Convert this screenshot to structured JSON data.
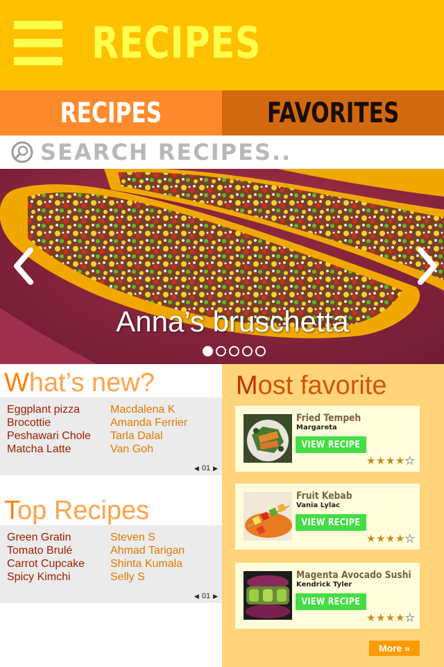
{
  "header": {
    "title": "RECIPES",
    "menu_icon": "hamburger-menu-icon"
  },
  "tabs": [
    {
      "label": "RECIPES",
      "active": true
    },
    {
      "label": "FAVORITES",
      "active": false
    }
  ],
  "search": {
    "placeholder": "SEARCH RECIPES..",
    "icon": "search-icon"
  },
  "hero": {
    "caption": "Anna’s bruschetta",
    "slide_count": 5,
    "active_slide": 1,
    "prev_icon": "chevron-left-icon",
    "next_icon": "chevron-right-icon"
  },
  "whats_new": {
    "title_first": "W",
    "title_rest": "hat’s new?",
    "items": [
      {
        "recipe": "Eggplant pizza",
        "author": "Macdalena K"
      },
      {
        "recipe": "Brocottie",
        "author": "Amanda Ferrier"
      },
      {
        "recipe": "Peshawari Chole",
        "author": "Tarla Dalal"
      },
      {
        "recipe": "Matcha Latte",
        "author": "Van Goh"
      }
    ],
    "page": "01"
  },
  "top_recipes": {
    "title_first": "T",
    "title_rest": "op Recipes",
    "items": [
      {
        "recipe": "Green Gratin",
        "author": "Steven S"
      },
      {
        "recipe": "Tomato Brulé",
        "author": "Ahmad Tarigan"
      },
      {
        "recipe": "Carrot Cupcake",
        "author": "Shinta Kumala"
      },
      {
        "recipe": "Spicy Kimchi",
        "author": "Selly S"
      }
    ],
    "page": "01"
  },
  "most_favorite": {
    "title_first": "M",
    "title_rest": "ost favorite",
    "cards": [
      {
        "name": "Fried Tempeh",
        "author": "Margareta",
        "button": "VIEW RECIPE",
        "rating": 4,
        "max_rating": 5
      },
      {
        "name": "Fruit Kebab",
        "author": "Vania Lylac",
        "button": "VIEW RECIPE",
        "rating": 4,
        "max_rating": 5
      },
      {
        "name": "Magenta Avocado Sushi",
        "author": "Kendrick Tyler",
        "button": "VIEW RECIPE",
        "rating": 4,
        "max_rating": 5
      }
    ],
    "more_label": "More »"
  },
  "colors": {
    "header_bg": "#ffc000",
    "accent_yellow": "#ffff4d",
    "tab_active": "#ff8a2b",
    "tab_inactive": "#d2690f",
    "right_panel": "#ffd47a",
    "button_green": "#44dd44",
    "more_button": "#ff9a00"
  }
}
